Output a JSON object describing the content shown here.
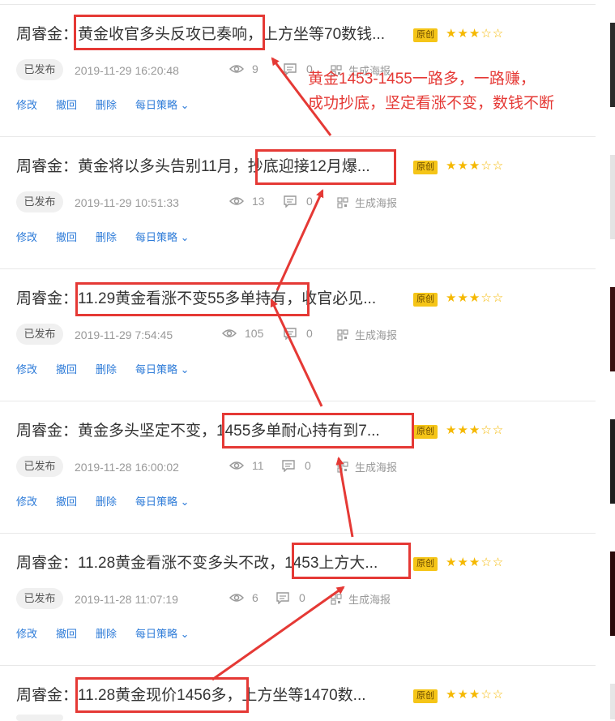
{
  "colors": {
    "accent": "#2d7bd8",
    "highlight": "#e53935",
    "badge": "#f5c518",
    "star": "#f5b800"
  },
  "articles": [
    {
      "title": "周睿金：黄金收官多头反攻已奏响，上方坐等70数钱...",
      "badge": "原创",
      "stars": "★★★☆☆",
      "status": "已发布",
      "date": "2019-11-29 16:20:48",
      "views": "9",
      "comments": "0",
      "poster": "生成海报",
      "actions": [
        "修改",
        "撤回",
        "删除",
        "每日策略"
      ]
    },
    {
      "title": "周睿金：黄金将以多头告别11月，抄底迎接12月爆...",
      "badge": "原创",
      "stars": "★★★☆☆",
      "status": "已发布",
      "date": "2019-11-29 10:51:33",
      "views": "13",
      "comments": "0",
      "poster": "生成海报",
      "actions": [
        "修改",
        "撤回",
        "删除",
        "每日策略"
      ]
    },
    {
      "title": "周睿金：11.29黄金看涨不变55多单持有，收官必见...",
      "badge": "原创",
      "stars": "★★★☆☆",
      "status": "已发布",
      "date": "2019-11-29 7:54:45",
      "views": "105",
      "comments": "0",
      "poster": "生成海报",
      "actions": [
        "修改",
        "撤回",
        "删除",
        "每日策略"
      ]
    },
    {
      "title": "周睿金：黄金多头坚定不变，1455多单耐心持有到7...",
      "badge": "原创",
      "stars": "★★★☆☆",
      "status": "已发布",
      "date": "2019-11-28 16:00:02",
      "views": "11",
      "comments": "0",
      "poster": "生成海报",
      "actions": [
        "修改",
        "撤回",
        "删除",
        "每日策略"
      ]
    },
    {
      "title": "周睿金：11.28黄金看涨不变多头不改，1453上方大...",
      "badge": "原创",
      "stars": "★★★☆☆",
      "status": "已发布",
      "date": "2019-11-28 11:07:19",
      "views": "6",
      "comments": "0",
      "poster": "生成海报",
      "actions": [
        "修改",
        "撤回",
        "删除",
        "每日策略"
      ]
    },
    {
      "title": "周睿金：11.28黄金现价1456多，上方坐等1470数...",
      "badge": "原创",
      "stars": "★★★☆☆",
      "status": "",
      "date": "",
      "views": "",
      "comments": "",
      "poster": "",
      "actions": []
    }
  ],
  "annotation": {
    "line1": "黄金1453-1455一路多，一路赚，",
    "line2": "成功抄底，坚定看涨不变，数钱不断"
  }
}
